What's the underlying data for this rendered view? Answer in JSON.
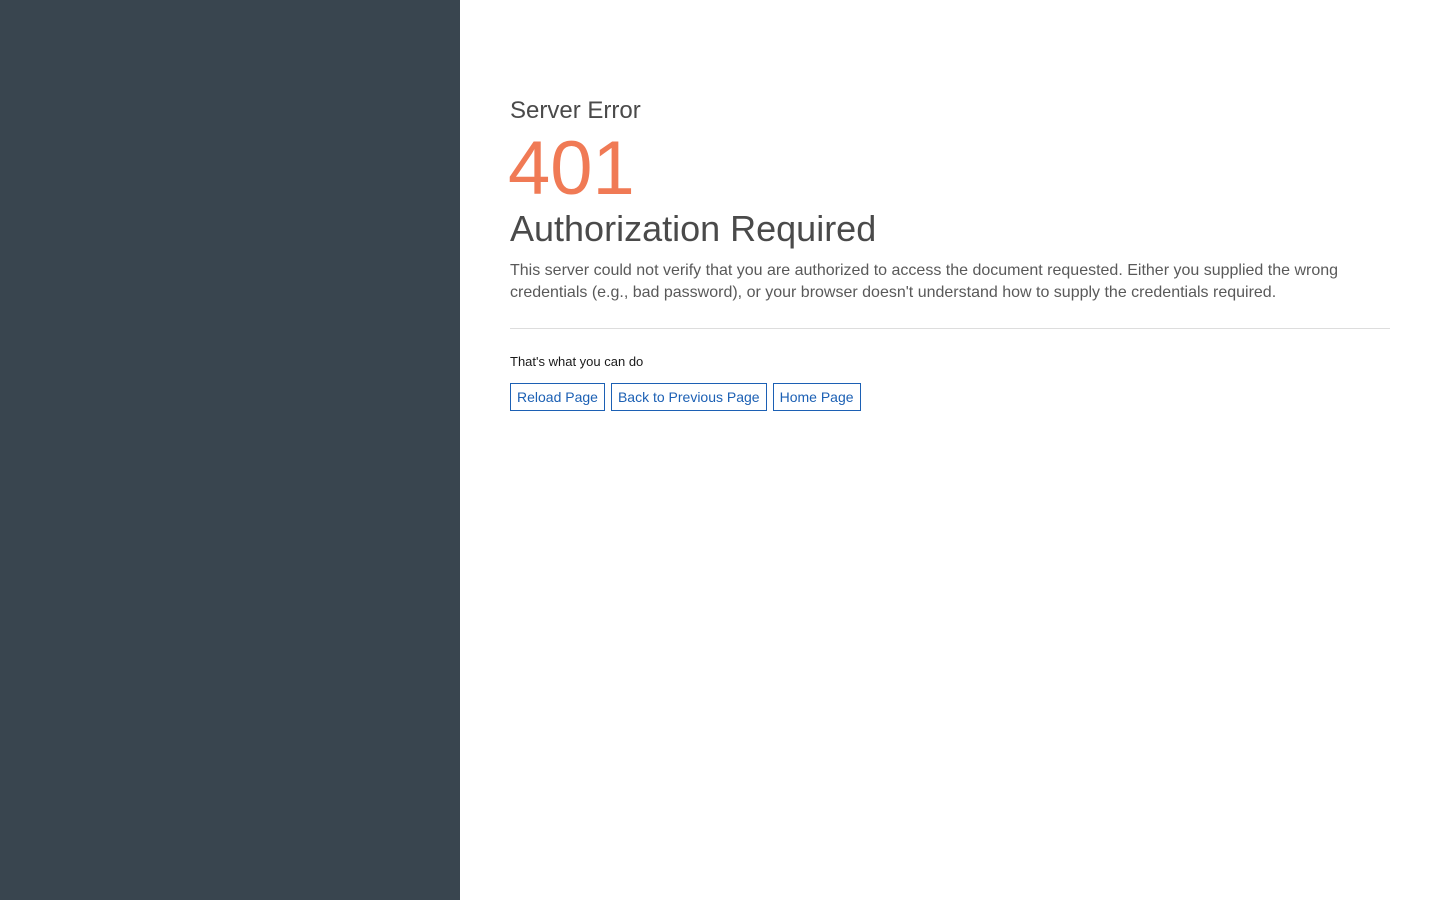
{
  "error": {
    "category": "Server Error",
    "code": "401",
    "title": "Authorization Required",
    "description": "This server could not verify that you are authorized to access the document requested. Either you supplied the wrong credentials (e.g., bad password), or your browser doesn't understand how to supply the credentials required."
  },
  "actions": {
    "label": "That's what you can do",
    "items": [
      {
        "label": "Reload Page"
      },
      {
        "label": "Back to Previous Page"
      },
      {
        "label": "Home Page"
      }
    ]
  },
  "colors": {
    "sidebar": "#39454f",
    "code": "#f07a55",
    "link": "#1c60b4"
  }
}
